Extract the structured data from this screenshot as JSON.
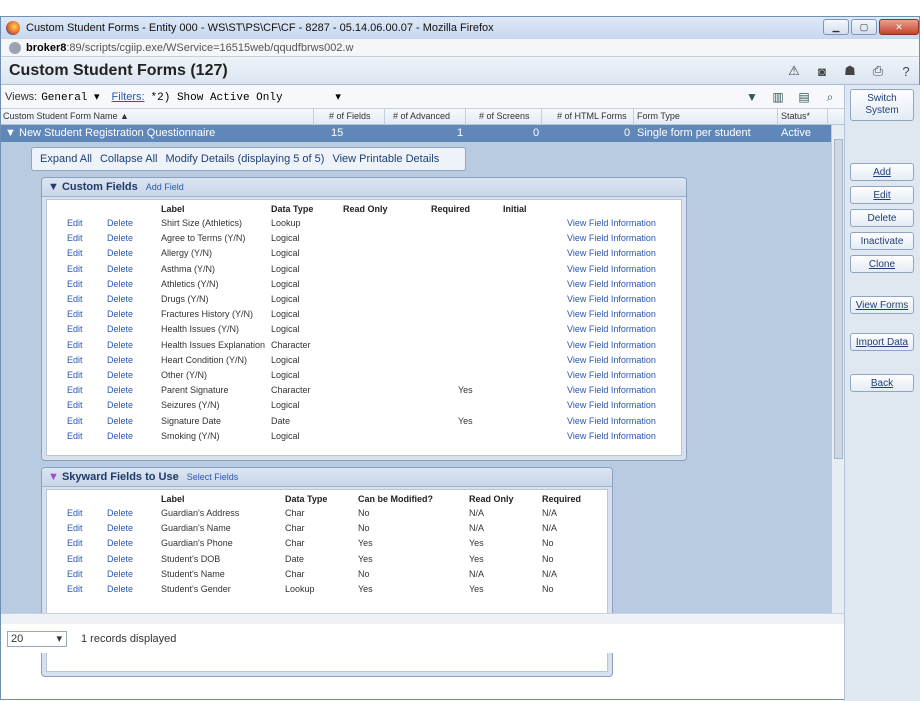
{
  "window": {
    "title": "Custom Student Forms - Entity 000 - WS\\ST\\PS\\CF\\CF - 8287 - 05.14.06.00.07 - Mozilla Firefox",
    "url_host": "broker8",
    "url_rest": ":89/scripts/cgiip.exe/WService=16515web/qqudfbrws002.w"
  },
  "app": {
    "title": "Custom Student Forms (127)"
  },
  "views": {
    "label": "Views:",
    "selected": "General",
    "filters_label": "Filters:",
    "filter_value": "*2) Show Active Only"
  },
  "grid": {
    "columns": [
      "Custom Student Form Name",
      "# of Fields",
      "# of Advanced",
      "# of Screens",
      "# of HTML Forms",
      "Form Type",
      "Status*"
    ],
    "row": {
      "name": "New Student Registration Questionnaire",
      "fields": "15",
      "advanced": "1",
      "screens": "0",
      "html_forms": "0",
      "form_type": "Single form per student",
      "status": "Active"
    }
  },
  "actions": {
    "expand_all": "Expand All",
    "collapse_all": "Collapse All",
    "modify_details": "Modify Details (displaying 5 of 5)",
    "view_printable": "View Printable Details"
  },
  "custom_fields": {
    "title": "Custom Fields",
    "add_link": "Add Field",
    "headers": [
      "Label",
      "Data Type",
      "Read Only",
      "Required",
      "Initial"
    ],
    "edit_label": "Edit",
    "delete_label": "Delete",
    "info_label": "View Field Information",
    "rows": [
      {
        "label": "Shirt Size (Athletics)",
        "type": "Lookup",
        "required": ""
      },
      {
        "label": "Agree to Terms (Y/N)",
        "type": "Logical",
        "required": ""
      },
      {
        "label": "Allergy (Y/N)",
        "type": "Logical",
        "required": ""
      },
      {
        "label": "Asthma (Y/N)",
        "type": "Logical",
        "required": ""
      },
      {
        "label": "Athletics (Y/N)",
        "type": "Logical",
        "required": ""
      },
      {
        "label": "Drugs (Y/N)",
        "type": "Logical",
        "required": ""
      },
      {
        "label": "Fractures History (Y/N)",
        "type": "Logical",
        "required": ""
      },
      {
        "label": "Health Issues (Y/N)",
        "type": "Logical",
        "required": ""
      },
      {
        "label": "Health Issues Explanation",
        "type": "Character",
        "required": ""
      },
      {
        "label": "Heart Condition (Y/N)",
        "type": "Logical",
        "required": ""
      },
      {
        "label": "Other (Y/N)",
        "type": "Logical",
        "required": ""
      },
      {
        "label": "Parent Signature",
        "type": "Character",
        "required": "Yes"
      },
      {
        "label": "Seizures (Y/N)",
        "type": "Logical",
        "required": ""
      },
      {
        "label": "Signature Date",
        "type": "Date",
        "required": "Yes"
      },
      {
        "label": "Smoking (Y/N)",
        "type": "Logical",
        "required": ""
      }
    ]
  },
  "skyward_fields": {
    "title": "Skyward Fields to Use",
    "select_link": "Select Fields",
    "headers": [
      "Label",
      "Data Type",
      "Can be Modified?",
      "Read Only",
      "Required"
    ],
    "edit_label": "Edit",
    "delete_label": "Delete",
    "rows": [
      {
        "label": "Guardian's Address",
        "type": "Char",
        "modified": "No",
        "read_only": "N/A",
        "required": "N/A"
      },
      {
        "label": "Guardian's Name",
        "type": "Char",
        "modified": "No",
        "read_only": "N/A",
        "required": "N/A"
      },
      {
        "label": "Guardian's Phone",
        "type": "Char",
        "modified": "Yes",
        "read_only": "Yes",
        "required": "No"
      },
      {
        "label": "Student's DOB",
        "type": "Date",
        "modified": "Yes",
        "read_only": "Yes",
        "required": "No"
      },
      {
        "label": "Student's Name",
        "type": "Char",
        "modified": "No",
        "read_only": "N/A",
        "required": "N/A"
      },
      {
        "label": "Student's Gender",
        "type": "Lookup",
        "modified": "Yes",
        "read_only": "Yes",
        "required": "No"
      }
    ]
  },
  "footer": {
    "page_size": "20",
    "records": "1 records displayed"
  },
  "sidebar": {
    "switch_line1": "Switch",
    "switch_line2": "System",
    "buttons": [
      "Add",
      "Edit",
      "Delete",
      "Inactivate",
      "Clone",
      "View Forms",
      "Import Data",
      "Back"
    ]
  }
}
